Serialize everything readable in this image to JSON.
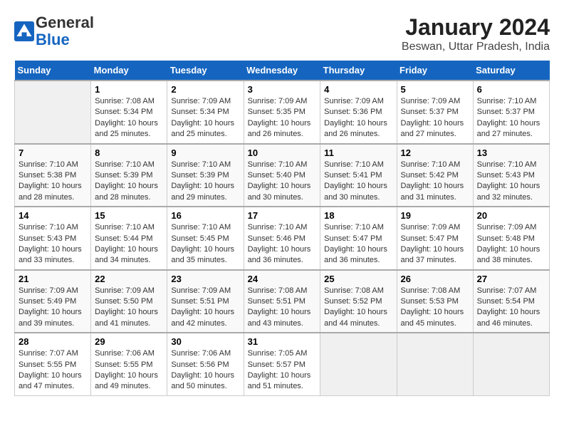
{
  "header": {
    "logo_line1": "General",
    "logo_line2": "Blue",
    "title": "January 2024",
    "subtitle": "Beswan, Uttar Pradesh, India"
  },
  "days_of_week": [
    "Sunday",
    "Monday",
    "Tuesday",
    "Wednesday",
    "Thursday",
    "Friday",
    "Saturday"
  ],
  "weeks": [
    [
      {
        "day": "",
        "info": ""
      },
      {
        "day": "1",
        "info": "Sunrise: 7:08 AM\nSunset: 5:34 PM\nDaylight: 10 hours\nand 25 minutes."
      },
      {
        "day": "2",
        "info": "Sunrise: 7:09 AM\nSunset: 5:34 PM\nDaylight: 10 hours\nand 25 minutes."
      },
      {
        "day": "3",
        "info": "Sunrise: 7:09 AM\nSunset: 5:35 PM\nDaylight: 10 hours\nand 26 minutes."
      },
      {
        "day": "4",
        "info": "Sunrise: 7:09 AM\nSunset: 5:36 PM\nDaylight: 10 hours\nand 26 minutes."
      },
      {
        "day": "5",
        "info": "Sunrise: 7:09 AM\nSunset: 5:37 PM\nDaylight: 10 hours\nand 27 minutes."
      },
      {
        "day": "6",
        "info": "Sunrise: 7:10 AM\nSunset: 5:37 PM\nDaylight: 10 hours\nand 27 minutes."
      }
    ],
    [
      {
        "day": "7",
        "info": "Sunrise: 7:10 AM\nSunset: 5:38 PM\nDaylight: 10 hours\nand 28 minutes."
      },
      {
        "day": "8",
        "info": "Sunrise: 7:10 AM\nSunset: 5:39 PM\nDaylight: 10 hours\nand 28 minutes."
      },
      {
        "day": "9",
        "info": "Sunrise: 7:10 AM\nSunset: 5:39 PM\nDaylight: 10 hours\nand 29 minutes."
      },
      {
        "day": "10",
        "info": "Sunrise: 7:10 AM\nSunset: 5:40 PM\nDaylight: 10 hours\nand 30 minutes."
      },
      {
        "day": "11",
        "info": "Sunrise: 7:10 AM\nSunset: 5:41 PM\nDaylight: 10 hours\nand 30 minutes."
      },
      {
        "day": "12",
        "info": "Sunrise: 7:10 AM\nSunset: 5:42 PM\nDaylight: 10 hours\nand 31 minutes."
      },
      {
        "day": "13",
        "info": "Sunrise: 7:10 AM\nSunset: 5:43 PM\nDaylight: 10 hours\nand 32 minutes."
      }
    ],
    [
      {
        "day": "14",
        "info": "Sunrise: 7:10 AM\nSunset: 5:43 PM\nDaylight: 10 hours\nand 33 minutes."
      },
      {
        "day": "15",
        "info": "Sunrise: 7:10 AM\nSunset: 5:44 PM\nDaylight: 10 hours\nand 34 minutes."
      },
      {
        "day": "16",
        "info": "Sunrise: 7:10 AM\nSunset: 5:45 PM\nDaylight: 10 hours\nand 35 minutes."
      },
      {
        "day": "17",
        "info": "Sunrise: 7:10 AM\nSunset: 5:46 PM\nDaylight: 10 hours\nand 36 minutes."
      },
      {
        "day": "18",
        "info": "Sunrise: 7:10 AM\nSunset: 5:47 PM\nDaylight: 10 hours\nand 36 minutes."
      },
      {
        "day": "19",
        "info": "Sunrise: 7:09 AM\nSunset: 5:47 PM\nDaylight: 10 hours\nand 37 minutes."
      },
      {
        "day": "20",
        "info": "Sunrise: 7:09 AM\nSunset: 5:48 PM\nDaylight: 10 hours\nand 38 minutes."
      }
    ],
    [
      {
        "day": "21",
        "info": "Sunrise: 7:09 AM\nSunset: 5:49 PM\nDaylight: 10 hours\nand 39 minutes."
      },
      {
        "day": "22",
        "info": "Sunrise: 7:09 AM\nSunset: 5:50 PM\nDaylight: 10 hours\nand 41 minutes."
      },
      {
        "day": "23",
        "info": "Sunrise: 7:09 AM\nSunset: 5:51 PM\nDaylight: 10 hours\nand 42 minutes."
      },
      {
        "day": "24",
        "info": "Sunrise: 7:08 AM\nSunset: 5:51 PM\nDaylight: 10 hours\nand 43 minutes."
      },
      {
        "day": "25",
        "info": "Sunrise: 7:08 AM\nSunset: 5:52 PM\nDaylight: 10 hours\nand 44 minutes."
      },
      {
        "day": "26",
        "info": "Sunrise: 7:08 AM\nSunset: 5:53 PM\nDaylight: 10 hours\nand 45 minutes."
      },
      {
        "day": "27",
        "info": "Sunrise: 7:07 AM\nSunset: 5:54 PM\nDaylight: 10 hours\nand 46 minutes."
      }
    ],
    [
      {
        "day": "28",
        "info": "Sunrise: 7:07 AM\nSunset: 5:55 PM\nDaylight: 10 hours\nand 47 minutes."
      },
      {
        "day": "29",
        "info": "Sunrise: 7:06 AM\nSunset: 5:55 PM\nDaylight: 10 hours\nand 49 minutes."
      },
      {
        "day": "30",
        "info": "Sunrise: 7:06 AM\nSunset: 5:56 PM\nDaylight: 10 hours\nand 50 minutes."
      },
      {
        "day": "31",
        "info": "Sunrise: 7:05 AM\nSunset: 5:57 PM\nDaylight: 10 hours\nand 51 minutes."
      },
      {
        "day": "",
        "info": ""
      },
      {
        "day": "",
        "info": ""
      },
      {
        "day": "",
        "info": ""
      }
    ]
  ]
}
